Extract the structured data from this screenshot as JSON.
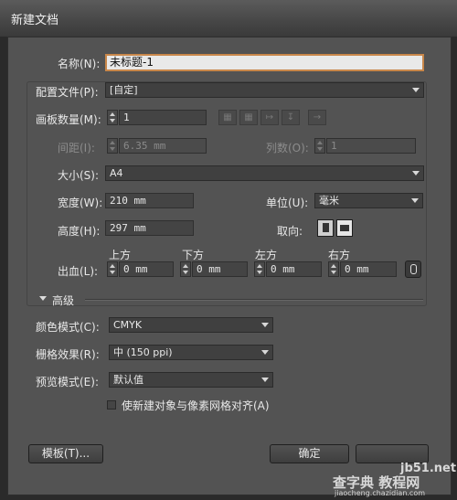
{
  "window": {
    "title": "新建文档"
  },
  "name": {
    "label": "名称(N):",
    "value": "未标题-1"
  },
  "profile": {
    "label": "配置文件(P):",
    "value": "[自定]"
  },
  "artboards": {
    "count_label": "画板数量(M):",
    "count_value": "1",
    "arrange_icons": [
      "grid-by-row-icon",
      "grid-by-column-icon",
      "arrange-by-row-icon",
      "arrange-by-column-icon",
      "right-to-left-icon"
    ],
    "spacing_label": "间距(I):",
    "spacing_value": "6.35 mm",
    "columns_label": "列数(O):",
    "columns_value": "1"
  },
  "size": {
    "label": "大小(S):",
    "value": "A4"
  },
  "width": {
    "label": "宽度(W):",
    "value": "210 mm"
  },
  "height": {
    "label": "高度(H):",
    "value": "297 mm"
  },
  "units": {
    "label": "单位(U):",
    "value": "毫米"
  },
  "orientation": {
    "label": "取向:",
    "options": [
      "portrait-icon",
      "landscape-icon"
    ]
  },
  "bleed": {
    "label": "出血(L):",
    "top_label": "上方",
    "top_value": "0 mm",
    "bottom_label": "下方",
    "bottom_value": "0 mm",
    "left_label": "左方",
    "left_value": "0 mm",
    "right_label": "右方",
    "right_value": "0 mm",
    "link_icon": "chain-link-icon"
  },
  "advanced": {
    "label": "高级",
    "color_mode_label": "颜色模式(C):",
    "color_mode_value": "CMYK",
    "raster_label": "栅格效果(R):",
    "raster_value": "中 (150 ppi)",
    "preview_label": "预览模式(E):",
    "preview_value": "默认值",
    "align_pixel_label": "使新建对象与像素网格对齐(A)"
  },
  "buttons": {
    "templates": "模板(T)...",
    "ok": "确定"
  },
  "watermark": {
    "line1": "jb51.net",
    "line2": "查字典 教程网",
    "line3": "jiaocheng.chazidian.com"
  }
}
